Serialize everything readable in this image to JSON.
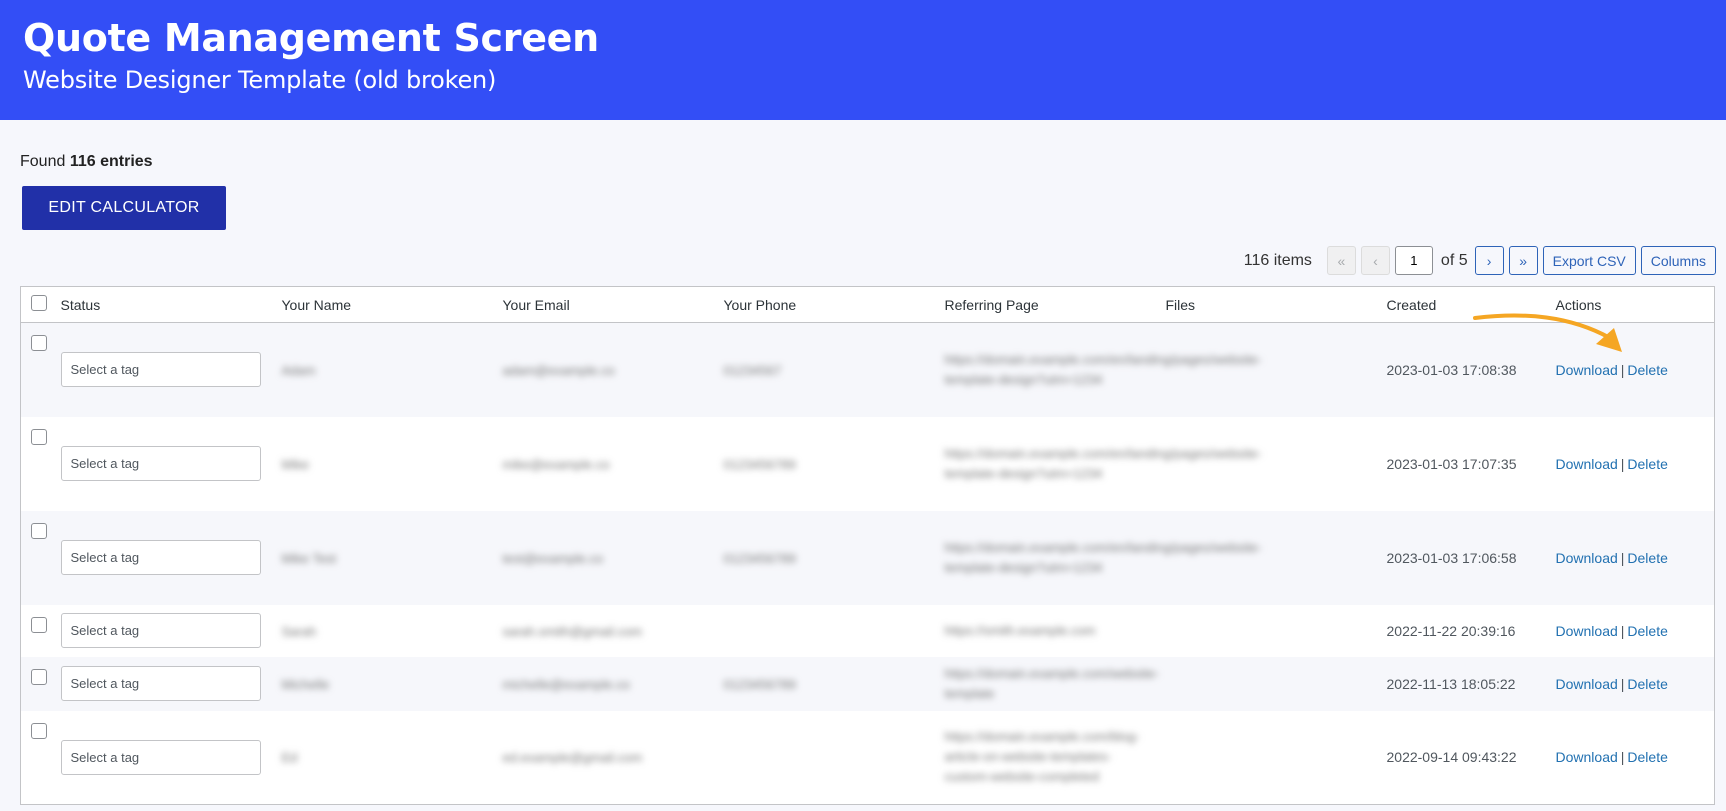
{
  "header": {
    "title": "Quote Management Screen",
    "subtitle": "Website Designer Template (old broken)"
  },
  "summary": {
    "found_prefix": "Found",
    "found_count": "116 entries"
  },
  "edit_button_label": "EDIT CALCULATOR",
  "pager": {
    "items_label": "116 items",
    "first": "«",
    "prev": "‹",
    "current_page": "1",
    "of_label": "of 5",
    "next": "›",
    "last": "»",
    "export_label": "Export CSV",
    "columns_label": "Columns"
  },
  "table": {
    "columns": [
      "Status",
      "Your Name",
      "Your Email",
      "Your Phone",
      "Referring Page",
      "Files",
      "Created",
      "Actions"
    ],
    "tag_placeholder": "Select a tag",
    "download_label": "Download",
    "delete_label": "Delete",
    "action_separator": "|",
    "rows": [
      {
        "name": "Adam",
        "email": "adam@example.co",
        "phone": "01234567",
        "referring": "https://domain.example.com/en/landing/pages/website-template-design?utm=1234",
        "created": "2023-01-03 17:08:38"
      },
      {
        "name": "Mike",
        "email": "mike@example.co",
        "phone": "0123456789",
        "referring": "https://domain.example.com/en/landing/pages/website-template-design?utm=1234",
        "created": "2023-01-03 17:07:35"
      },
      {
        "name": "Mike Test",
        "email": "test@example.co",
        "phone": "0123456789",
        "referring": "https://domain.example.com/en/landing/pages/website-template-design?utm=1234",
        "created": "2023-01-03 17:06:58"
      },
      {
        "name": "Sarah",
        "email": "sarah.smith@gmail.com",
        "phone": "",
        "referring": "https://smith.example.com",
        "created": "2022-11-22 20:39:16"
      },
      {
        "name": "Michelle",
        "email": "michelle@example.co",
        "phone": "0123456789",
        "referring": "https://domain.example.com/website-template",
        "created": "2022-11-13 18:05:22"
      },
      {
        "name": "Ed",
        "email": "ed.example@gmail.com",
        "phone": "",
        "referring": "https://domain.example.com/blog-article-on-website-templates-custom-website-completed",
        "created": "2022-09-14 09:43:22"
      }
    ]
  }
}
